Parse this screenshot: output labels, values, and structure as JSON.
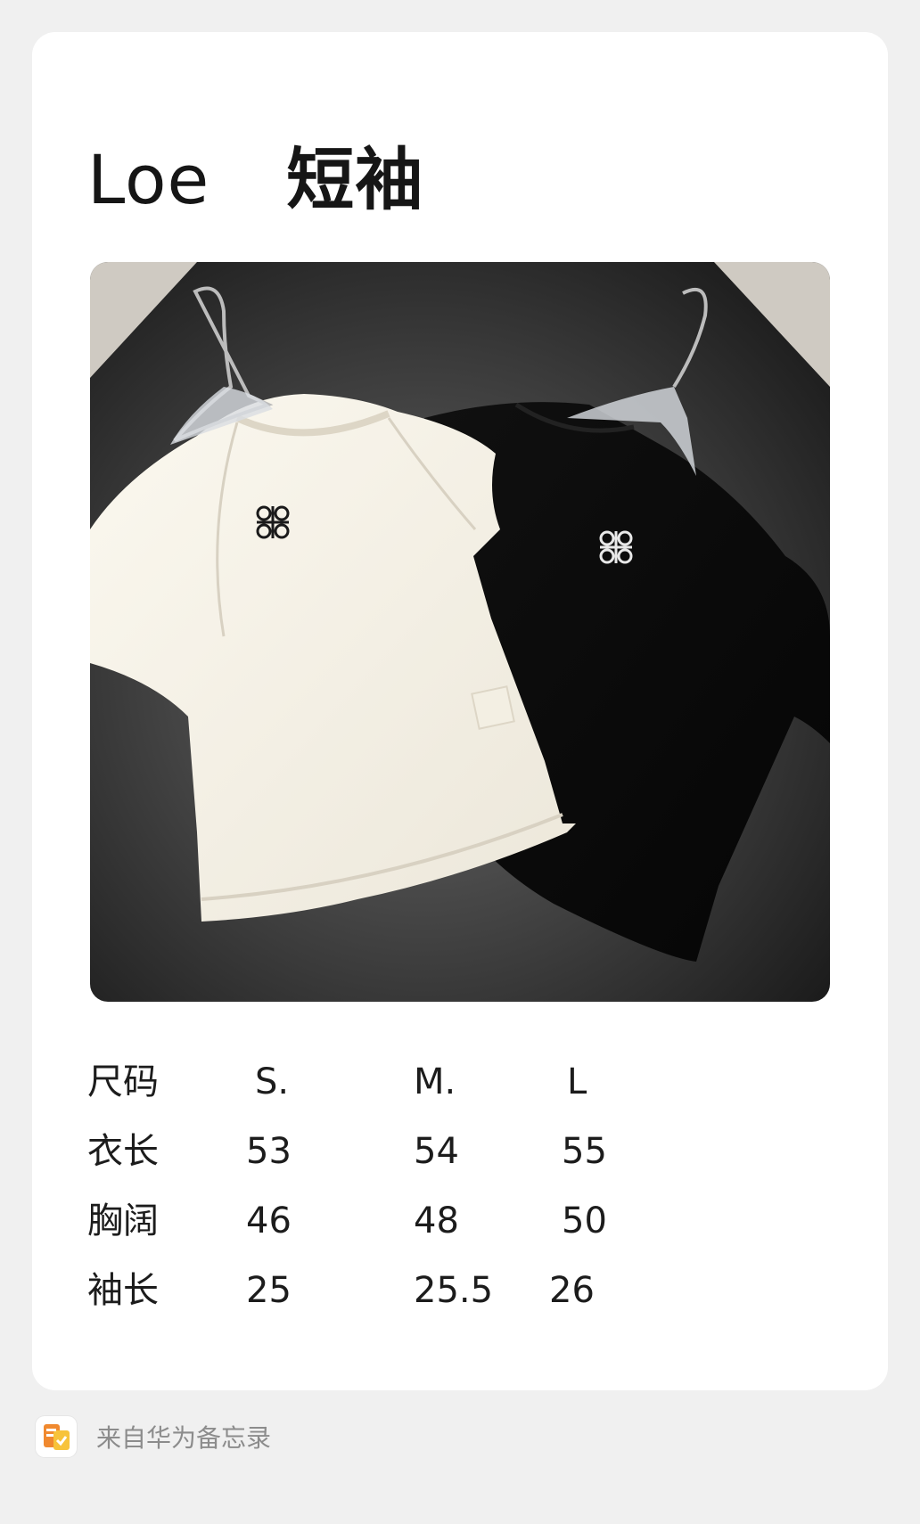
{
  "note": {
    "title_brand": "Loe",
    "title_item": "短袖"
  },
  "size_table": {
    "rows": [
      {
        "label": "尺码",
        "values": [
          "S.",
          "M.",
          "L"
        ]
      },
      {
        "label": "衣长",
        "values": [
          "53",
          "54",
          "55"
        ]
      },
      {
        "label": "胸阔",
        "values": [
          "46",
          "48",
          "50"
        ]
      },
      {
        "label": "袖长",
        "values": [
          "25",
          "25.5",
          "26"
        ]
      }
    ]
  },
  "footer": {
    "source_text": "来自华为备忘录",
    "app_icon": "memo-app-icon"
  }
}
